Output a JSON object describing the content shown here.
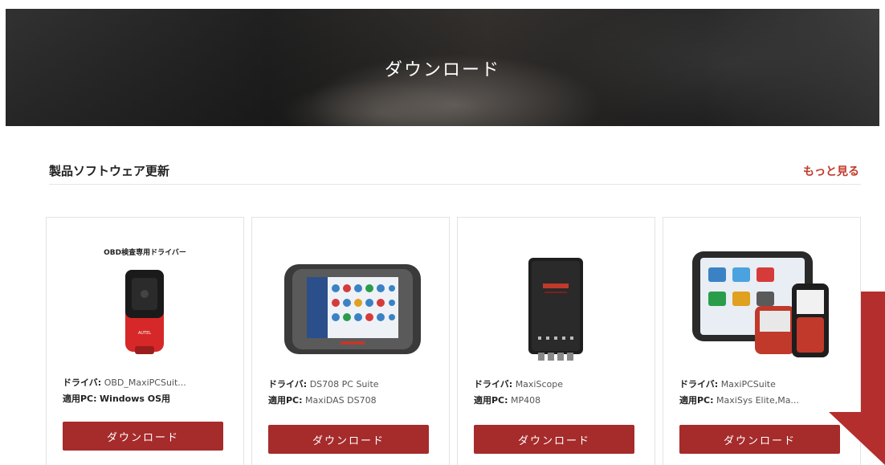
{
  "hero": {
    "title": "ダウンロード"
  },
  "section": {
    "title": "製品ソフトウェア更新",
    "more": "もっと見る"
  },
  "cards": [
    {
      "img_caption": "OBD検査専用ドライバー",
      "driver_label": "ドライバ:",
      "driver_value": "OBD_MaxiPCSuit...",
      "pc_label": "適用PC:",
      "pc_value": "Windows OS用",
      "button": "ダウンロード"
    },
    {
      "driver_label": "ドライバ:",
      "driver_value": "DS708 PC Suite",
      "pc_label": "適用PC:",
      "pc_value": "MaxiDAS DS708",
      "button": "ダウンロード"
    },
    {
      "driver_label": "ドライバ:",
      "driver_value": "MaxiScope",
      "pc_label": "適用PC:",
      "pc_value": "MP408",
      "button": "ダウンロード"
    },
    {
      "driver_label": "ドライバ:",
      "driver_value": "MaxiPCSuite",
      "pc_label": "適用PC:",
      "pc_value": "MaxiSys Elite,Ma...",
      "button": "ダウンロード"
    }
  ],
  "colors": {
    "accent": "#a62b2b",
    "link": "#c0392b",
    "arrow": "#b52e2e"
  }
}
